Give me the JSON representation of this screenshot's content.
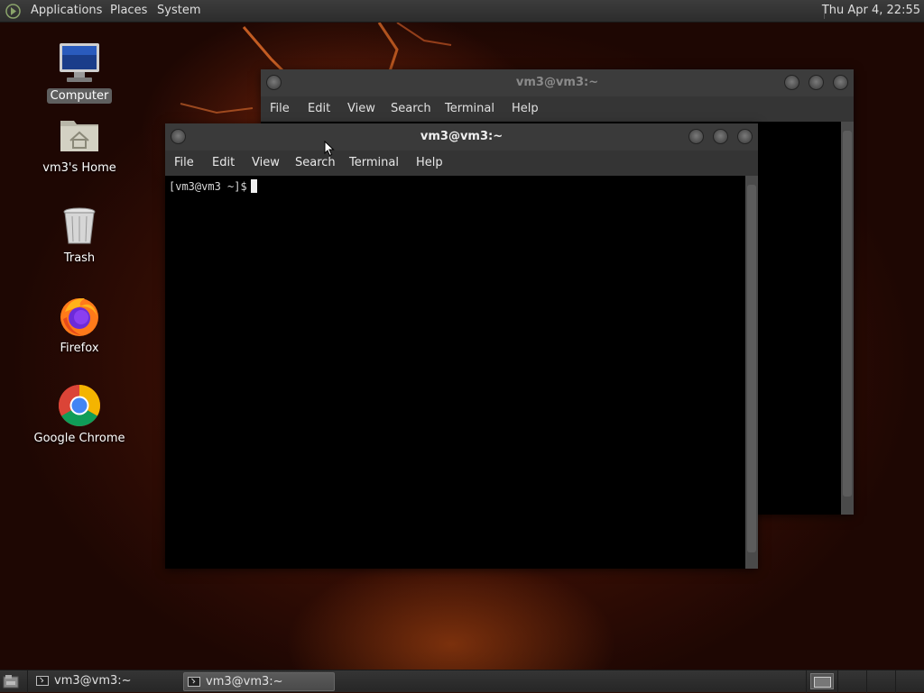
{
  "top_panel": {
    "menus": [
      "Applications",
      "Places",
      "System"
    ],
    "clock": "Thu Apr  4, 22:55"
  },
  "desktop_icons": [
    {
      "label": "Computer",
      "icon": "computer-icon",
      "selected": true
    },
    {
      "label": "vm3's Home",
      "icon": "home-folder-icon",
      "selected": false
    },
    {
      "label": "Trash",
      "icon": "trash-icon",
      "selected": false
    },
    {
      "label": "Firefox",
      "icon": "firefox-icon",
      "selected": false
    },
    {
      "label": "Google Chrome",
      "icon": "chrome-icon",
      "selected": false
    }
  ],
  "windows": {
    "back": {
      "title": "vm3@vm3:~",
      "menu": [
        "File",
        "Edit",
        "View",
        "Search",
        "Terminal",
        "Help"
      ]
    },
    "front": {
      "title": "vm3@vm3:~",
      "menu": [
        "File",
        "Edit",
        "View",
        "Search",
        "Terminal",
        "Help"
      ],
      "prompt": "[vm3@vm3 ~]$"
    }
  },
  "taskbar": {
    "tasks": [
      {
        "label": "vm3@vm3:~",
        "active": false
      },
      {
        "label": "vm3@vm3:~",
        "active": true
      }
    ]
  },
  "colors": {
    "panel": "#2c2c2c",
    "terminal_bg": "#000000",
    "wallpaper": "#3a0f05"
  }
}
